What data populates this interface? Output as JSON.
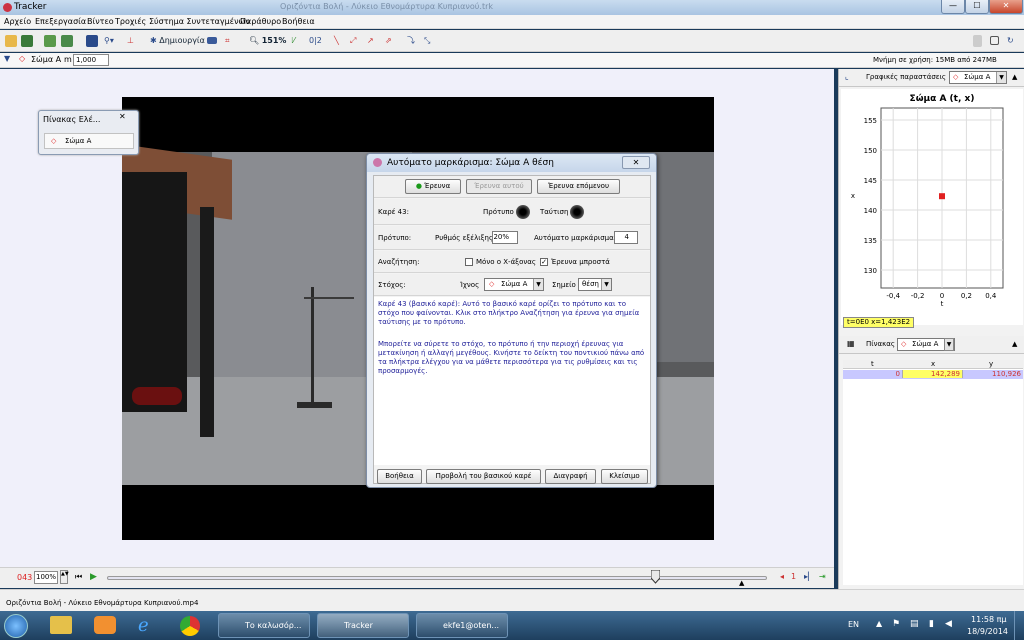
{
  "window": {
    "app_title": "Tracker",
    "ghost_title": "Οριζόντια Βολή - Λύκειο Εθνομάρτυρα Κυπριανού.trk",
    "min": "—",
    "max": "☐",
    "close": "✕"
  },
  "menu": [
    "Αρχείο",
    "Επεξεργασία",
    "Βίντεο",
    "Τροχιές",
    "Σύστημα Συντεταγμένων",
    "Παράθυρο",
    "Βοήθεια"
  ],
  "toolbar": {
    "create_label": "Δημιουργία",
    "zoom_label": "151%",
    "subscript_label": "0|2"
  },
  "trackbar": {
    "track_name": "Σώμα Α",
    "mass_label": "m",
    "mass_value": "1,000",
    "memory_label": "Μνήμη σε χρήση: 15MB από 247MB"
  },
  "element_pad": {
    "title": "Πίνακας Ελέ...",
    "item": "Σώμα Α"
  },
  "dialog": {
    "title": "Αυτόματο μαρκάρισμα: Σώμα Α θέση",
    "btn_search": "Έρευνα",
    "btn_search_this": "Έρευνα αυτού",
    "btn_search_next": "Έρευνα επόμενου",
    "frame_label": "Καρέ 43:",
    "template_label": "Πρότυπο",
    "match_label": "Ταύτιση",
    "template_row_label": "Πρότυπο:",
    "evolution_label": "Ρυθμός εξέλιξης",
    "evolution_value": "20%",
    "auto_mark_label": "Αυτόματο μαρκάρισμα",
    "auto_mark_value": "4",
    "search_row_label": "Αναζήτηση:",
    "x_axis_only_label": "Μόνο ο Χ-άξονας",
    "x_axis_only_checked": false,
    "search_ahead_label": "Έρευνα μπροστά",
    "search_ahead_checked": true,
    "target_row_label": "Στόχος:",
    "track_label": "Ίχνος",
    "track_value": "Σώμα Α",
    "point_label": "Σημείο",
    "point_value": "θέση",
    "message_1": "Καρέ 43 (βασικό καρέ): Αυτό το βασικό καρέ ορίζει το πρότυπο και το στόχο που φαίνονται. Κλικ στο πλήκτρο Αναζήτηση για έρευνα για σημεία ταύτισης με το πρότυπο.",
    "message_2": "Μπορείτε να σύρετε το στόχο, το πρότυπο ή την περιοχή έρευνας για μετακίνηση ή αλλαγή μεγέθους. Κινήστε το δείκτη του ποντικιού πάνω από τα πλήκτρα ελέγχου για να μάθετε περισσότερα για τις ρυθμίσεις και τις προσαρμογές.",
    "btn_help": "Βοήθεια",
    "btn_show_keyframe": "Προβολή του βασικού καρέ",
    "btn_delete": "Διαγραφή",
    "btn_close": "Κλείσιμο",
    "close_glyph": "✕"
  },
  "player": {
    "frame_number": "043",
    "zoom": "100%",
    "step": "1",
    "slider_position": 0.83
  },
  "status": {
    "filename": "Οριζόντια Βολή - Λύκειο Εθνομάρτυρα Κυπριανού.mp4"
  },
  "plot_panel": {
    "header": "Γραφικές παραστάσεις",
    "track": "Σώμα Α",
    "readout": "t=0E0  x=1,423E2"
  },
  "table_panel": {
    "header": "Πίνακας",
    "track": "Σώμα Α",
    "columns": [
      "t",
      "x",
      "y"
    ],
    "rows": [
      [
        "0",
        "142,289",
        "110,926"
      ]
    ]
  },
  "chart_data": {
    "type": "scatter",
    "title": "Σώμα Α (t, x)",
    "xlabel": "t",
    "ylabel": "x",
    "xlim": [
      -0.5,
      0.5
    ],
    "ylim": [
      127,
      157
    ],
    "xticks": [
      "-0,4",
      "-0,2",
      "0",
      "0,2",
      "0,4"
    ],
    "xtick_values": [
      -0.4,
      -0.2,
      0,
      0.2,
      0.4
    ],
    "yticks": [
      "130",
      "135",
      "140",
      "145",
      "150",
      "155"
    ],
    "ytick_values": [
      130,
      135,
      140,
      145,
      150,
      155
    ],
    "grid": true,
    "series": [
      {
        "x": [
          0
        ],
        "y": [
          142.3
        ],
        "color": "#e02020"
      }
    ]
  },
  "taskbar": {
    "items": [
      "Το καλωσόρ...",
      "Tracker",
      "ekfe1@oten..."
    ],
    "lang": "EN",
    "time": "11:58 πμ",
    "date": "18/9/2014"
  },
  "colors": {
    "accent": "#3b5998",
    "track_red": "#e02020",
    "readout_bg": "#ffff66",
    "selected_row": "#c8c8ff"
  }
}
